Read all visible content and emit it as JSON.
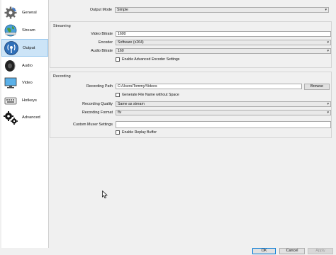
{
  "sidebar": {
    "items": [
      {
        "label": "General",
        "icon": "gear-icon"
      },
      {
        "label": "Stream",
        "icon": "globe-icon"
      },
      {
        "label": "Output",
        "icon": "antenna-icon"
      },
      {
        "label": "Audio",
        "icon": "speaker-icon"
      },
      {
        "label": "Video",
        "icon": "monitor-icon"
      },
      {
        "label": "Hotkeys",
        "icon": "keyboard-icon"
      },
      {
        "label": "Advanced",
        "icon": "gears-icon"
      }
    ],
    "active": "Output"
  },
  "output_mode": {
    "label": "Output Mode",
    "value": "Simple"
  },
  "streaming": {
    "title": "Streaming",
    "video_bitrate_label": "Video Bitrate",
    "video_bitrate_value": "1600",
    "encoder_label": "Encoder",
    "encoder_value": "Software (x264)",
    "audio_bitrate_label": "Audio Bitrate",
    "audio_bitrate_value": "160",
    "advanced_encoder_label": "Enable Advanced Encoder Settings"
  },
  "recording": {
    "title": "Recording",
    "path_label": "Recording Path",
    "path_value": "C:/Users/Tommy/Videos",
    "browse_label": "Browse",
    "no_space_label": "Generate File Name without Space",
    "quality_label": "Recording Quality",
    "quality_value": "Same as stream",
    "format_label": "Recording Format",
    "format_value": "flv",
    "muxer_label": "Custom Muxer Settings",
    "muxer_value": "",
    "replay_label": "Enable Replay Buffer"
  },
  "buttons": {
    "ok": "OK",
    "cancel": "Cancel",
    "apply": "Apply"
  },
  "colors": {
    "accent": "#0078d7",
    "active_nav": "#cce4f7"
  }
}
